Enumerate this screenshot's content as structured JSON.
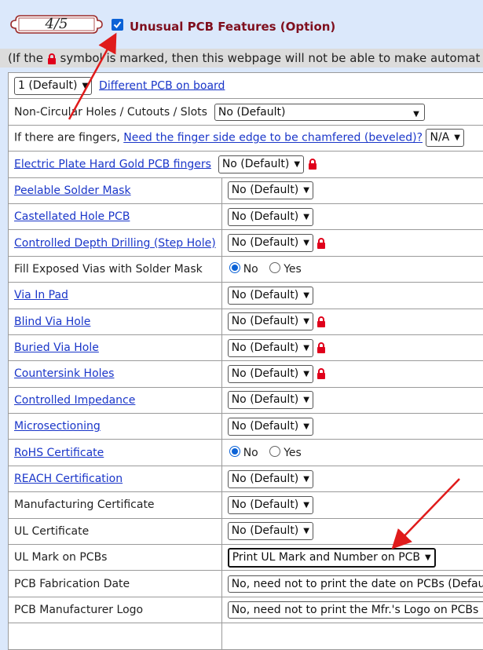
{
  "header": {
    "step_badge": "4/5",
    "option_checkbox_checked": true,
    "option_title": "Unusual PCB Features (Option)",
    "note_prefix": "(If the",
    "note_suffix": "symbol is marked, then this webpage will not be able to make automat"
  },
  "colors": {
    "accent": "#7f0f1e",
    "link": "#1a36c9",
    "lock": "#e0001b",
    "arrow": "#e01b1b"
  },
  "rows": {
    "r0": {
      "select": "1 (Default)",
      "link": "Different PCB on board"
    },
    "r1": {
      "label": "Non-Circular Holes / Cutouts / Slots",
      "select": "No (Default)"
    },
    "r2": {
      "label": "If there are fingers,",
      "link": "Need the finger side edge to be chamfered (beveled)?",
      "select": "N/A"
    },
    "r3": {
      "link": "Electric Plate Hard Gold PCB fingers",
      "select": "No (Default)"
    },
    "r4": {
      "link": "Peelable Solder Mask",
      "select": "No (Default)"
    },
    "r5": {
      "link": "Castellated Hole PCB",
      "select": "No (Default)"
    },
    "r6": {
      "link": "Controlled Depth Drilling (Step Hole)",
      "select": "No (Default)"
    },
    "r7": {
      "label": "Fill Exposed Vias with Solder Mask",
      "opt_no": "No",
      "opt_yes": "Yes"
    },
    "r8": {
      "link": "Via In Pad",
      "select": "No (Default)"
    },
    "r9": {
      "link": "Blind Via Hole",
      "select": "No (Default)"
    },
    "r10": {
      "link": "Buried Via Hole",
      "select": "No (Default)"
    },
    "r11": {
      "link": "Countersink Holes",
      "select": "No (Default)"
    },
    "r12": {
      "link": "Controlled Impedance",
      "select": "No (Default)"
    },
    "r13": {
      "link": "Microsectioning",
      "select": "No (Default)"
    },
    "r14": {
      "link": "RoHS Certificate",
      "opt_no": "No",
      "opt_yes": "Yes"
    },
    "r15": {
      "link": "REACH Certification",
      "select": "No (Default)"
    },
    "r16": {
      "label": "Manufacturing Certificate",
      "select": "No (Default)"
    },
    "r17": {
      "label": "UL Certificate",
      "select": "No (Default)"
    },
    "r18": {
      "label": "UL Mark on PCBs",
      "select": "Print UL Mark and Number on PCB"
    },
    "r19": {
      "label": "PCB Fabrication Date",
      "select": "No, need not to print the date on PCBs (Default)"
    },
    "r20": {
      "label": "PCB Manufacturer Logo",
      "select": "No, need not to print the Mfr.'s Logo on PCBs (D"
    }
  }
}
